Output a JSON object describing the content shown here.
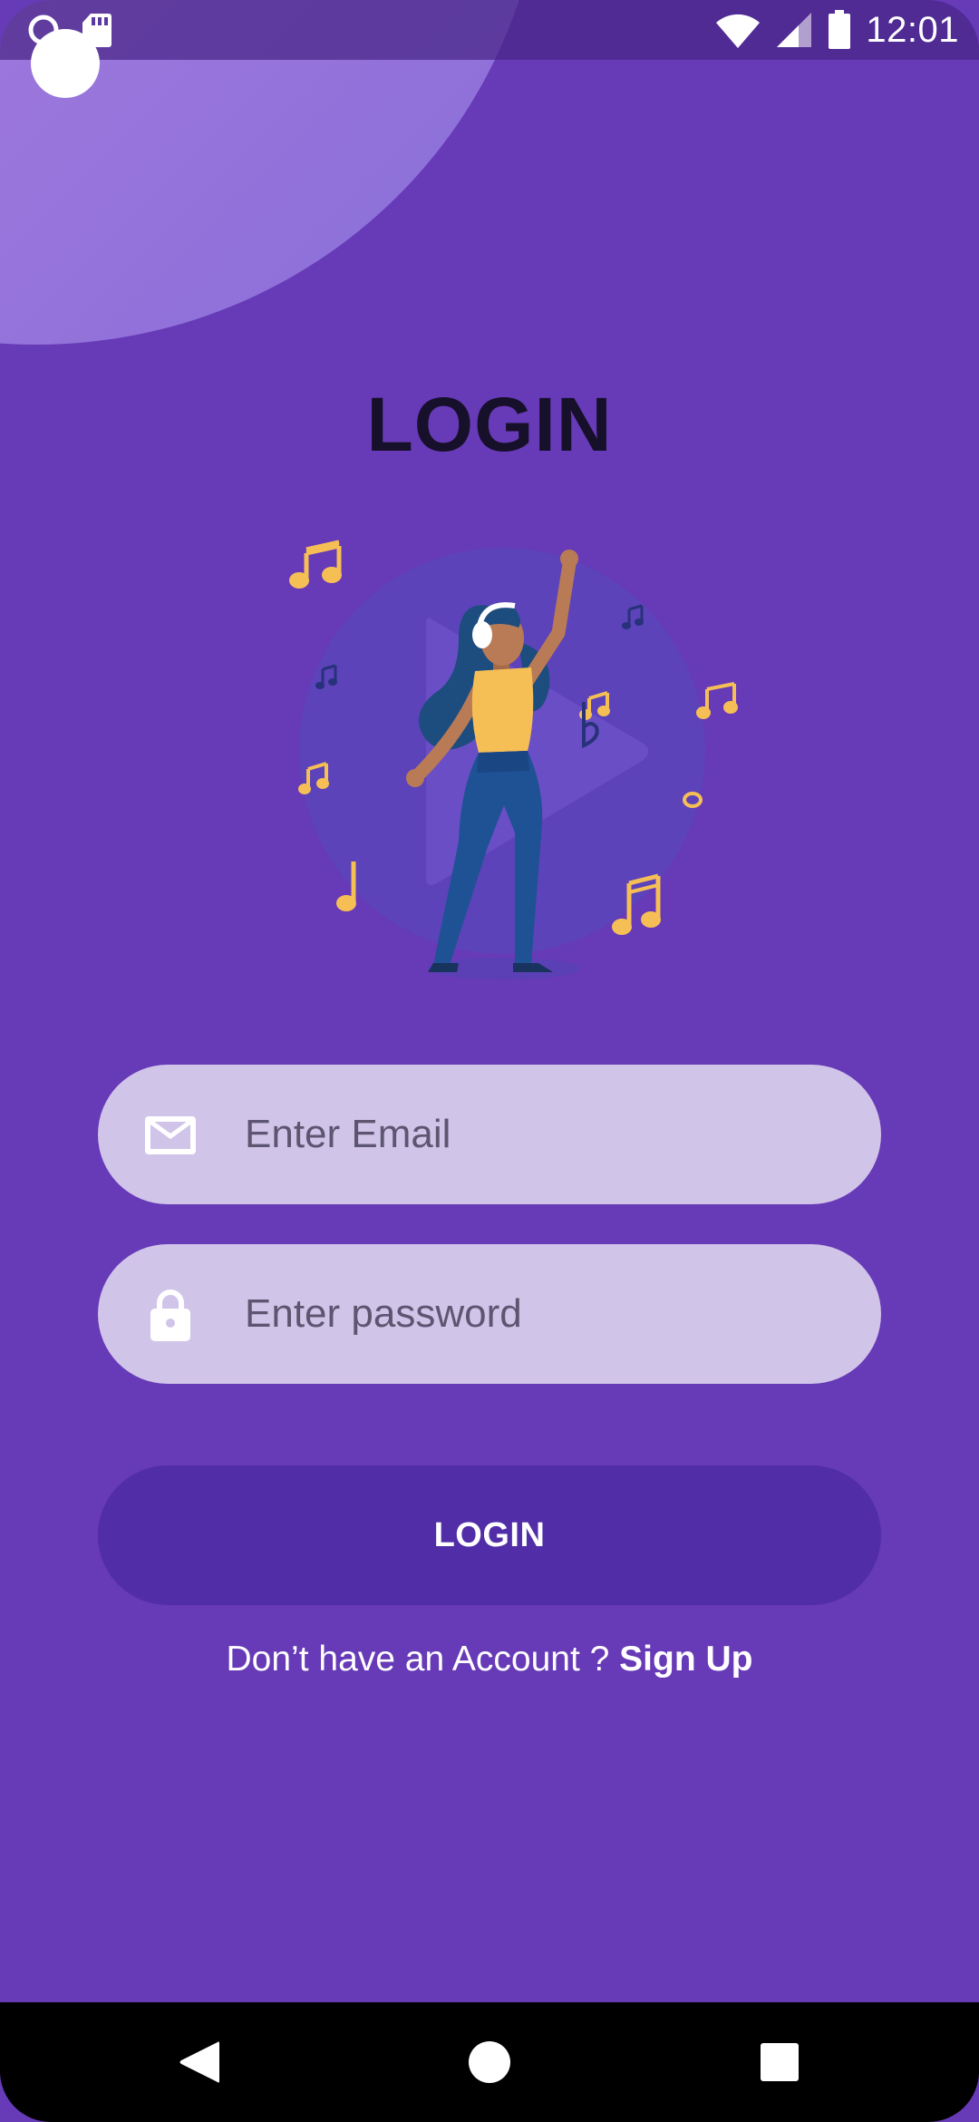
{
  "status_bar": {
    "time": "12:01",
    "icons": [
      "notification-ring-icon",
      "sd-card-icon",
      "wifi-icon",
      "cell-signal-icon",
      "battery-icon"
    ]
  },
  "title": "LOGIN",
  "illustration": {
    "icon": "dancing-girl-music-illustration"
  },
  "email_field": {
    "icon": "mail-icon",
    "placeholder": "Enter Email",
    "value": ""
  },
  "password_field": {
    "icon": "lock-icon",
    "placeholder": "Enter password",
    "value": ""
  },
  "login_button": {
    "label": "LOGIN"
  },
  "signup": {
    "prompt": "Don’t have an Account ?",
    "link": "Sign Up"
  },
  "nav_bar": {
    "icons": [
      "back-icon",
      "home-icon",
      "recents-icon"
    ]
  },
  "colors": {
    "background": "#673ab7",
    "field_background": "#d1c4e9",
    "button_background": "#512da8",
    "title_color": "#17102a",
    "accent_yellow": "#f6bf56"
  }
}
